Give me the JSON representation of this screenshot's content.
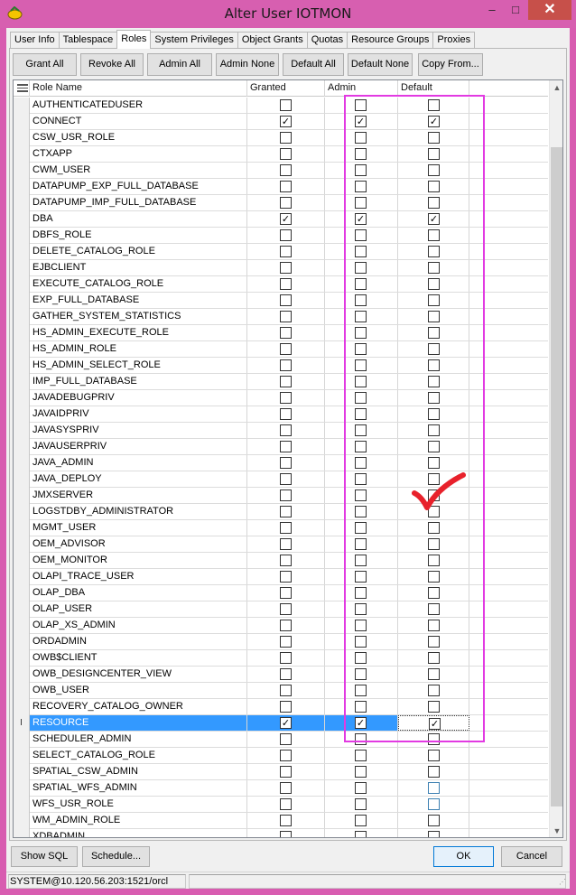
{
  "window": {
    "title": "Alter User IOTMON",
    "minimize_glyph": "–",
    "maximize_glyph": "□",
    "close_glyph": "✕"
  },
  "tabs": [
    "User Info",
    "Tablespace",
    "Roles",
    "System Privileges",
    "Object Grants",
    "Quotas",
    "Resource Groups",
    "Proxies"
  ],
  "active_tab": "Roles",
  "toolbar": {
    "grant_all": "Grant All",
    "revoke_all": "Revoke All",
    "admin_all": "Admin All",
    "admin_none": "Admin None",
    "default_all": "Default All",
    "default_none": "Default None",
    "copy_from": "Copy From..."
  },
  "grid": {
    "columns": [
      "Role Name",
      "Granted",
      "Admin",
      "Default"
    ],
    "rows": [
      {
        "name": "AUTHENTICATEDUSER",
        "granted": false,
        "admin": false,
        "default": false
      },
      {
        "name": "CONNECT",
        "granted": true,
        "admin": true,
        "default": true
      },
      {
        "name": "CSW_USR_ROLE",
        "granted": false,
        "admin": false,
        "default": false
      },
      {
        "name": "CTXAPP",
        "granted": false,
        "admin": false,
        "default": false
      },
      {
        "name": "CWM_USER",
        "granted": false,
        "admin": false,
        "default": false
      },
      {
        "name": "DATAPUMP_EXP_FULL_DATABASE",
        "granted": false,
        "admin": false,
        "default": false
      },
      {
        "name": "DATAPUMP_IMP_FULL_DATABASE",
        "granted": false,
        "admin": false,
        "default": false
      },
      {
        "name": "DBA",
        "granted": true,
        "admin": true,
        "default": true
      },
      {
        "name": "DBFS_ROLE",
        "granted": false,
        "admin": false,
        "default": false
      },
      {
        "name": "DELETE_CATALOG_ROLE",
        "granted": false,
        "admin": false,
        "default": false
      },
      {
        "name": "EJBCLIENT",
        "granted": false,
        "admin": false,
        "default": false
      },
      {
        "name": "EXECUTE_CATALOG_ROLE",
        "granted": false,
        "admin": false,
        "default": false
      },
      {
        "name": "EXP_FULL_DATABASE",
        "granted": false,
        "admin": false,
        "default": false
      },
      {
        "name": "GATHER_SYSTEM_STATISTICS",
        "granted": false,
        "admin": false,
        "default": false
      },
      {
        "name": "HS_ADMIN_EXECUTE_ROLE",
        "granted": false,
        "admin": false,
        "default": false
      },
      {
        "name": "HS_ADMIN_ROLE",
        "granted": false,
        "admin": false,
        "default": false
      },
      {
        "name": "HS_ADMIN_SELECT_ROLE",
        "granted": false,
        "admin": false,
        "default": false
      },
      {
        "name": "IMP_FULL_DATABASE",
        "granted": false,
        "admin": false,
        "default": false
      },
      {
        "name": "JAVADEBUGPRIV",
        "granted": false,
        "admin": false,
        "default": false
      },
      {
        "name": "JAVAIDPRIV",
        "granted": false,
        "admin": false,
        "default": false
      },
      {
        "name": "JAVASYSPRIV",
        "granted": false,
        "admin": false,
        "default": false
      },
      {
        "name": "JAVAUSERPRIV",
        "granted": false,
        "admin": false,
        "default": false
      },
      {
        "name": "JAVA_ADMIN",
        "granted": false,
        "admin": false,
        "default": false
      },
      {
        "name": "JAVA_DEPLOY",
        "granted": false,
        "admin": false,
        "default": false
      },
      {
        "name": "JMXSERVER",
        "granted": false,
        "admin": false,
        "default": false
      },
      {
        "name": "LOGSTDBY_ADMINISTRATOR",
        "granted": false,
        "admin": false,
        "default": false
      },
      {
        "name": "MGMT_USER",
        "granted": false,
        "admin": false,
        "default": false
      },
      {
        "name": "OEM_ADVISOR",
        "granted": false,
        "admin": false,
        "default": false
      },
      {
        "name": "OEM_MONITOR",
        "granted": false,
        "admin": false,
        "default": false
      },
      {
        "name": "OLAPI_TRACE_USER",
        "granted": false,
        "admin": false,
        "default": false
      },
      {
        "name": "OLAP_DBA",
        "granted": false,
        "admin": false,
        "default": false
      },
      {
        "name": "OLAP_USER",
        "granted": false,
        "admin": false,
        "default": false
      },
      {
        "name": "OLAP_XS_ADMIN",
        "granted": false,
        "admin": false,
        "default": false
      },
      {
        "name": "ORDADMIN",
        "granted": false,
        "admin": false,
        "default": false
      },
      {
        "name": "OWB$CLIENT",
        "granted": false,
        "admin": false,
        "default": false
      },
      {
        "name": "OWB_DESIGNCENTER_VIEW",
        "granted": false,
        "admin": false,
        "default": false
      },
      {
        "name": "OWB_USER",
        "granted": false,
        "admin": false,
        "default": false
      },
      {
        "name": "RECOVERY_CATALOG_OWNER",
        "granted": false,
        "admin": false,
        "default": false
      },
      {
        "name": "RESOURCE",
        "granted": true,
        "admin": true,
        "default": true,
        "selected": true,
        "indicator": "I"
      },
      {
        "name": "SCHEDULER_ADMIN",
        "granted": false,
        "admin": false,
        "default": false
      },
      {
        "name": "SELECT_CATALOG_ROLE",
        "granted": false,
        "admin": false,
        "default": false
      },
      {
        "name": "SPATIAL_CSW_ADMIN",
        "granted": false,
        "admin": false,
        "default": false
      },
      {
        "name": "SPATIAL_WFS_ADMIN",
        "granted": false,
        "admin": false,
        "default": false,
        "default_hover": true
      },
      {
        "name": "WFS_USR_ROLE",
        "granted": false,
        "admin": false,
        "default": false,
        "default_hover": true
      },
      {
        "name": "WM_ADMIN_ROLE",
        "granted": false,
        "admin": false,
        "default": false
      },
      {
        "name": "XDBADMIN",
        "granted": false,
        "admin": false,
        "default": false
      }
    ]
  },
  "scrollbar": {
    "up": "▲",
    "down": "▼"
  },
  "buttons": {
    "show_sql": "Show SQL",
    "schedule": "Schedule...",
    "ok": "OK",
    "cancel": "Cancel"
  },
  "status": {
    "connection": "SYSTEM@10.120.56.203:1521/orcl"
  },
  "colors": {
    "frame": "#d85cb0",
    "selection": "#3399ff",
    "annotation": "#e23ae2",
    "check_annotation": "#e8212b"
  }
}
